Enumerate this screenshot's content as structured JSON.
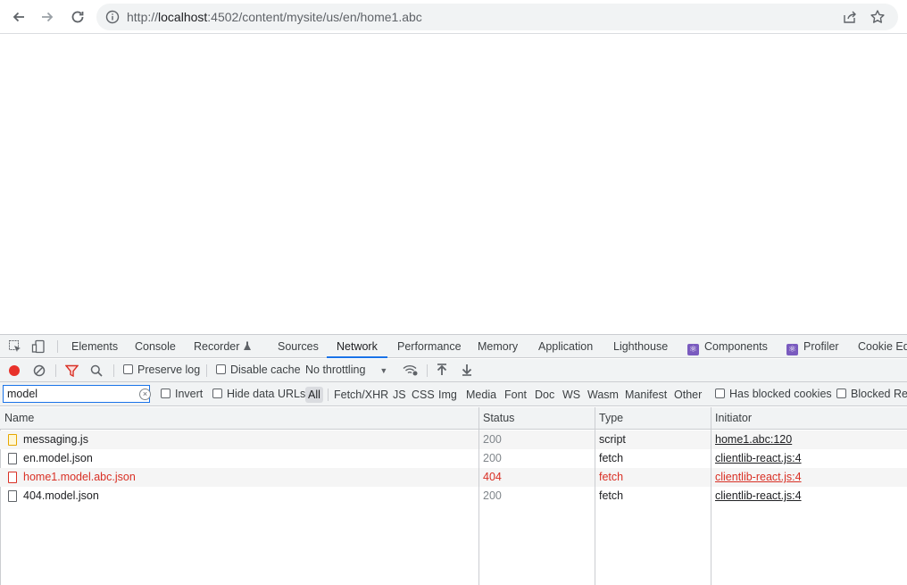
{
  "browser": {
    "url_prefix": "http://",
    "url_host": "localhost",
    "url_rest": ":4502/content/mysite/us/en/home1.abc"
  },
  "devtools": {
    "tabs": [
      "Elements",
      "Console",
      "Recorder",
      "Sources",
      "Network",
      "Performance",
      "Memory",
      "Application",
      "Lighthouse",
      "Components",
      "Profiler",
      "Cookie Edi"
    ],
    "active_tab": "Network",
    "toolbar": {
      "preserve_log": "Preserve log",
      "disable_cache": "Disable cache",
      "throttling": "No throttling"
    },
    "filter": {
      "value": "model",
      "invert": "Invert",
      "hide_data_urls": "Hide data URLs",
      "types": [
        "All",
        "Fetch/XHR",
        "JS",
        "CSS",
        "Img",
        "Media",
        "Font",
        "Doc",
        "WS",
        "Wasm",
        "Manifest",
        "Other"
      ],
      "selected_type": "All",
      "has_blocked_cookies": "Has blocked cookies",
      "blocked_requests": "Blocked Rec"
    },
    "table": {
      "columns": [
        "Name",
        "Status",
        "Type",
        "Initiator"
      ],
      "rows": [
        {
          "name": "messaging.js",
          "status": "200",
          "type": "script",
          "initiator": "home1.abc:120"
        },
        {
          "name": "en.model.json",
          "status": "200",
          "type": "fetch",
          "initiator": "clientlib-react.js:4"
        },
        {
          "name": "home1.model.abc.json",
          "status": "404",
          "type": "fetch",
          "initiator": "clientlib-react.js:4"
        },
        {
          "name": "404.model.json",
          "status": "200",
          "type": "fetch",
          "initiator": "clientlib-react.js:4"
        }
      ]
    }
  },
  "colors": {
    "accent": "#1a73e8",
    "error": "#d93025",
    "record": "#e8312a",
    "filter_icon": "#d93025"
  },
  "icons": [
    "back-arrow-icon",
    "forward-arrow-icon",
    "reload-icon",
    "info-icon",
    "share-icon",
    "star-icon",
    "inspect-icon",
    "device-toolbar-icon",
    "recorder-flask-icon",
    "record-icon",
    "clear-icon",
    "filter-icon",
    "search-icon",
    "wifi-settings-icon",
    "upload-icon",
    "download-icon",
    "clear-input-icon",
    "file-icon"
  ]
}
